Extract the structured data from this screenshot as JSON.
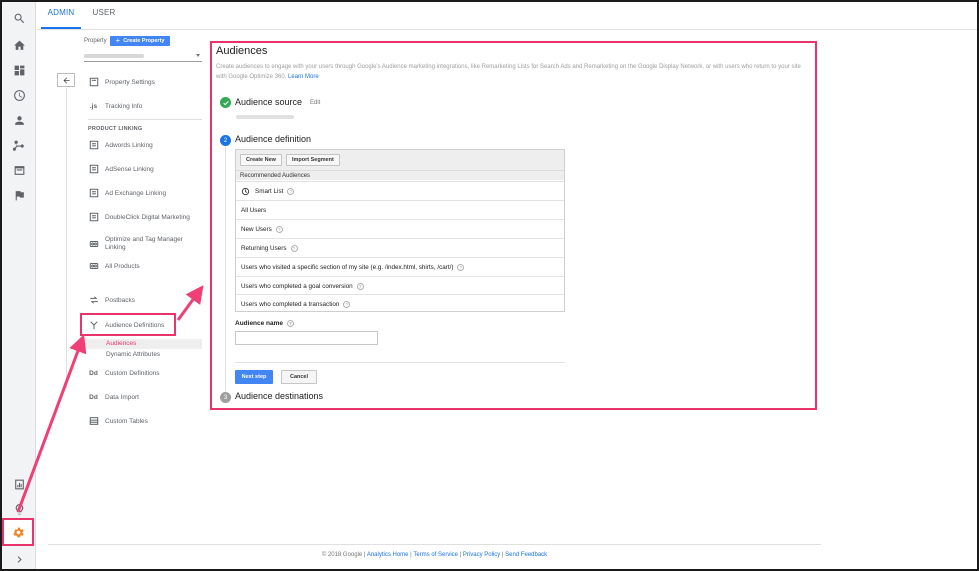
{
  "tabs": {
    "admin": "ADMIN",
    "user": "USER"
  },
  "property": {
    "label": "Property",
    "create_button": "Create Property"
  },
  "nav": {
    "property_settings": "Property Settings",
    "tracking_info": "Tracking Info",
    "tracking_icon_text": ".js",
    "section_product_linking": "PRODUCT LINKING",
    "adwords": "Adwords Linking",
    "adsense": "AdSense Linking",
    "ad_exchange": "Ad Exchange Linking",
    "doubleclick": "DoubleClick Digital Marketing",
    "optimize_line1": "Optimize and Tag Manager",
    "optimize_line2": "Linking",
    "all_products": "All Products",
    "postbacks": "Postbacks",
    "audience_definitions": "Audience Definitions",
    "sub_audiences": "Audiences",
    "sub_dynamic_attributes": "Dynamic Attributes",
    "custom_definitions": "Custom Definitions",
    "data_import": "Data Import",
    "dd_icon_text": "Dd",
    "custom_tables": "Custom Tables"
  },
  "main": {
    "title": "Audiences",
    "description": "Create audiences to engage with your users through Google's Audience marketing integrations, like Remarketing Lists for Search Ads and Remarketing on the Google Display Network, or with users who return to your site with Google Optimize 360.",
    "learn_more": "Learn More",
    "step1": {
      "title": "Audience source",
      "edit": "Edit"
    },
    "step2": {
      "number": "2",
      "title": "Audience definition"
    },
    "step3": {
      "number": "3",
      "title": "Audience destinations"
    },
    "toolbar": {
      "create_new": "Create New",
      "import_segment": "Import Segment"
    },
    "recommended_heading": "Recommended Audiences",
    "audiences": [
      "Smart List",
      "All Users",
      "New Users",
      "Returning Users",
      "Users who visited a specific section of my site (e.g. /index.html, shirts, /cart/)",
      "Users who completed a goal conversion",
      "Users who completed a transaction"
    ],
    "help_mark": "?",
    "audience_name_label": "Audience name",
    "audience_name_value": "",
    "next_step": "Next step",
    "cancel": "Cancel"
  },
  "footer": {
    "copyright": "© 2018 Google",
    "sep": " | ",
    "analytics_home": "Analytics Home",
    "terms": "Terms of Service",
    "privacy": "Privacy Policy",
    "feedback": "Send Feedback"
  },
  "colors": {
    "accent_blue": "#4285f4",
    "highlight_pink": "#e8336b",
    "gear_orange": "#f4811f",
    "step_done_green": "#34a853",
    "step_active_blue": "#1a73e8",
    "step_pending_gray": "#9e9e9e"
  }
}
